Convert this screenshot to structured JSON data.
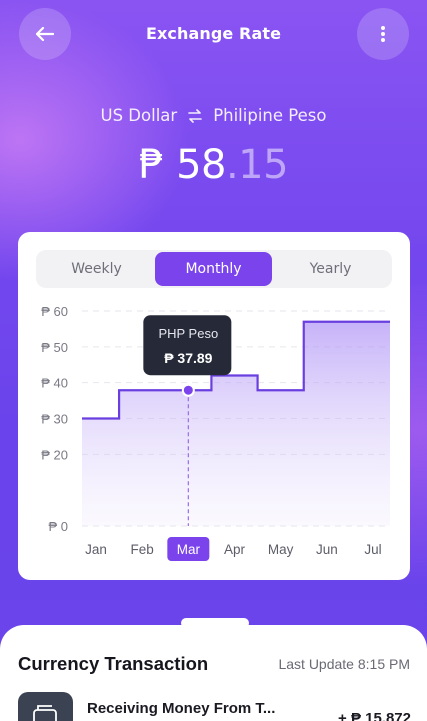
{
  "header": {
    "title": "Exchange Rate",
    "back_icon": "arrow-left-icon",
    "menu_icon": "more-vertical-icon"
  },
  "currency_pair": {
    "from": "US Dollar",
    "swap_icon": "swap-arrows-icon",
    "to": "Philipine Peso"
  },
  "rate": {
    "symbol": "₱",
    "integer": "58",
    "decimal": ".15"
  },
  "tabs": [
    {
      "label": "Weekly",
      "active": false
    },
    {
      "label": "Monthly",
      "active": true
    },
    {
      "label": "Yearly",
      "active": false
    }
  ],
  "tooltip": {
    "title": "PHP Peso",
    "value": "₱ 37.89"
  },
  "colors": {
    "accent": "#7a43ec",
    "line": "#6a3fe0"
  },
  "chart_data": {
    "type": "area",
    "step": true,
    "categories": [
      "Jan",
      "Feb",
      "Mar",
      "Apr",
      "May",
      "Jun",
      "Jul"
    ],
    "selected_category": "Mar",
    "y_tick_labels": [
      "₱ 60",
      "₱ 50",
      "₱ 40",
      "₱ 30",
      "₱ 20",
      "₱ 0"
    ],
    "ylim": [
      0,
      60
    ],
    "grid": true,
    "series": [
      {
        "points": [
          {
            "x": "Jan",
            "y": 30
          },
          {
            "x": "Feb",
            "y": 37.89
          },
          {
            "x": "Mar",
            "y": 37.89
          },
          {
            "x": "Apr",
            "y": 42
          },
          {
            "x": "May",
            "y": 37.89
          },
          {
            "x": "Jun",
            "y": 57
          },
          {
            "x": "Jul",
            "y": 57
          }
        ]
      }
    ],
    "highlight_point": {
      "x": "Mar",
      "y": 37.89
    }
  },
  "transactions": {
    "title": "Currency Transaction",
    "last_update": "Last Update 8:15 PM",
    "items": [
      {
        "icon": "wallet-icon",
        "title": "Receiving Money From T...",
        "amount": "+ ₱ 15,872"
      }
    ]
  }
}
